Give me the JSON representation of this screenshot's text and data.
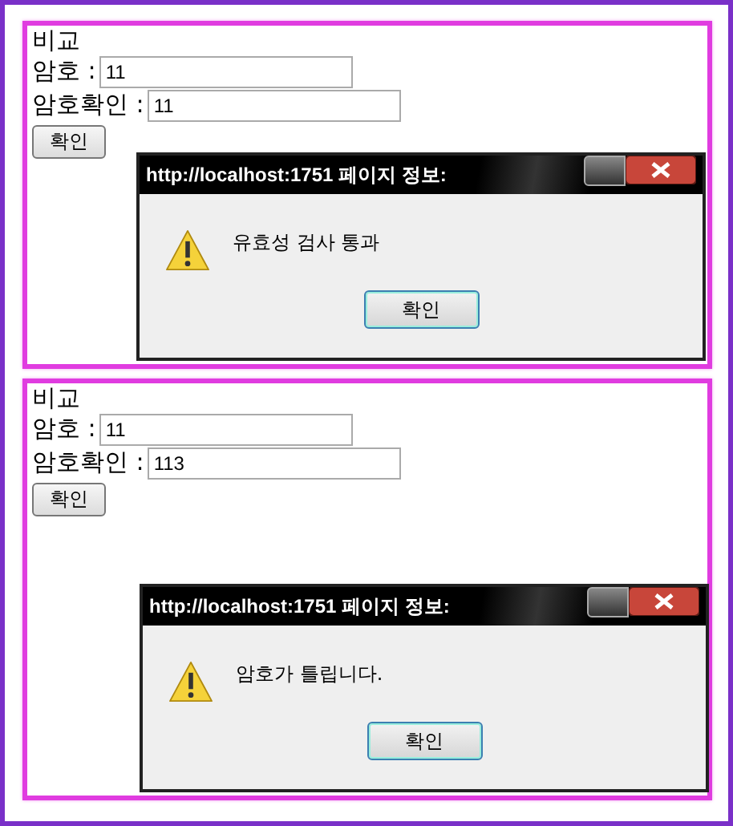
{
  "panels": [
    {
      "heading": "비교",
      "fields": [
        {
          "label": "암호 :",
          "value": "11"
        },
        {
          "label": "암호확인 :",
          "value": "11"
        }
      ],
      "button": "확인",
      "dialog": {
        "title": "http://localhost:1751 페이지 정보:",
        "message": "유효성 검사 통과",
        "button": "확인"
      }
    },
    {
      "heading": "비교",
      "fields": [
        {
          "label": "암호 :",
          "value": "11"
        },
        {
          "label": "암호확인 :",
          "value": "113"
        }
      ],
      "button": "확인",
      "dialog": {
        "title": "http://localhost:1751 페이지 정보:",
        "message": "암호가 틀립니다.",
        "button": "확인"
      }
    }
  ]
}
